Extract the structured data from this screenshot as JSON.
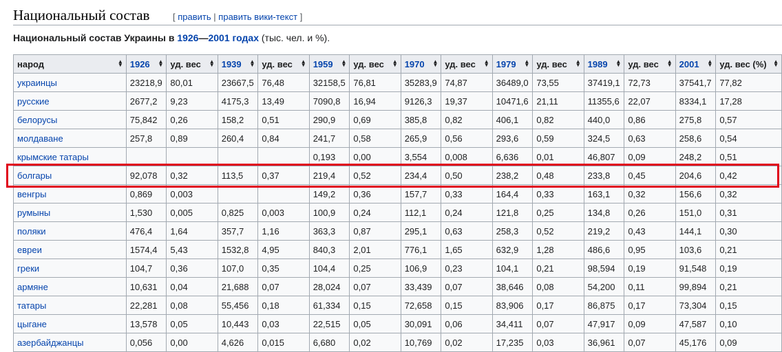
{
  "section": {
    "title": "Национальный состав",
    "edit_open": "[",
    "edit_link": "править",
    "edit_sep": "|",
    "edit_wiki_link": "править вики-текст",
    "edit_close": "]"
  },
  "caption": {
    "prefix": "Национальный состав Украины в ",
    "link1": "1926",
    "dash": "—",
    "link2": "2001 годах",
    "suffix": " (тыс. чел. и %)."
  },
  "table": {
    "headers": [
      "народ",
      "1926",
      "уд. вес",
      "1939",
      "уд. вес",
      "1959",
      "уд. вес",
      "1970",
      "уд. вес",
      "1979",
      "уд. вес",
      "1989",
      "уд. вес",
      "2001",
      "уд. вес (%)"
    ],
    "rows": [
      [
        "украинцы",
        "23218,9",
        "80,01",
        "23667,5",
        "76,48",
        "32158,5",
        "76,81",
        "35283,9",
        "74,87",
        "36489,0",
        "73,55",
        "37419,1",
        "72,73",
        "37541,7",
        "77,82"
      ],
      [
        "русские",
        "2677,2",
        "9,23",
        "4175,3",
        "13,49",
        "7090,8",
        "16,94",
        "9126,3",
        "19,37",
        "10471,6",
        "21,11",
        "11355,6",
        "22,07",
        "8334,1",
        "17,28"
      ],
      [
        "белорусы",
        "75,842",
        "0,26",
        "158,2",
        "0,51",
        "290,9",
        "0,69",
        "385,8",
        "0,82",
        "406,1",
        "0,82",
        "440,0",
        "0,86",
        "275,8",
        "0,57"
      ],
      [
        "молдаване",
        "257,8",
        "0,89",
        "260,4",
        "0,84",
        "241,7",
        "0,58",
        "265,9",
        "0,56",
        "293,6",
        "0,59",
        "324,5",
        "0,63",
        "258,6",
        "0,54"
      ],
      [
        "крымские татары",
        "",
        "",
        "",
        "",
        "0,193",
        "0,00",
        "3,554",
        "0,008",
        "6,636",
        "0,01",
        "46,807",
        "0,09",
        "248,2",
        "0,51"
      ],
      [
        "болгары",
        "92,078",
        "0,32",
        "113,5",
        "0,37",
        "219,4",
        "0,52",
        "234,4",
        "0,50",
        "238,2",
        "0,48",
        "233,8",
        "0,45",
        "204,6",
        "0,42"
      ],
      [
        "венгры",
        "0,869",
        "0,003",
        "",
        "",
        "149,2",
        "0,36",
        "157,7",
        "0,33",
        "164,4",
        "0,33",
        "163,1",
        "0,32",
        "156,6",
        "0,32"
      ],
      [
        "румыны",
        "1,530",
        "0,005",
        "0,825",
        "0,003",
        "100,9",
        "0,24",
        "112,1",
        "0,24",
        "121,8",
        "0,25",
        "134,8",
        "0,26",
        "151,0",
        "0,31"
      ],
      [
        "поляки",
        "476,4",
        "1,64",
        "357,7",
        "1,16",
        "363,3",
        "0,87",
        "295,1",
        "0,63",
        "258,3",
        "0,52",
        "219,2",
        "0,43",
        "144,1",
        "0,30"
      ],
      [
        "евреи",
        "1574,4",
        "5,43",
        "1532,8",
        "4,95",
        "840,3",
        "2,01",
        "776,1",
        "1,65",
        "632,9",
        "1,28",
        "486,6",
        "0,95",
        "103,6",
        "0,21"
      ],
      [
        "греки",
        "104,7",
        "0,36",
        "107,0",
        "0,35",
        "104,4",
        "0,25",
        "106,9",
        "0,23",
        "104,1",
        "0,21",
        "98,594",
        "0,19",
        "91,548",
        "0,19"
      ],
      [
        "армяне",
        "10,631",
        "0,04",
        "21,688",
        "0,07",
        "28,024",
        "0,07",
        "33,439",
        "0,07",
        "38,646",
        "0,08",
        "54,200",
        "0,11",
        "99,894",
        "0,21"
      ],
      [
        "татары",
        "22,281",
        "0,08",
        "55,456",
        "0,18",
        "61,334",
        "0,15",
        "72,658",
        "0,15",
        "83,906",
        "0,17",
        "86,875",
        "0,17",
        "73,304",
        "0,15"
      ],
      [
        "цыгане",
        "13,578",
        "0,05",
        "10,443",
        "0,03",
        "22,515",
        "0,05",
        "30,091",
        "0,06",
        "34,411",
        "0,07",
        "47,917",
        "0,09",
        "47,587",
        "0,10"
      ],
      [
        "азербайджанцы",
        "0,056",
        "0,00",
        "4,626",
        "0,015",
        "6,680",
        "0,02",
        "10,769",
        "0,02",
        "17,235",
        "0,03",
        "36,961",
        "0,07",
        "45,176",
        "0,09"
      ]
    ]
  },
  "colors": {
    "link": "#0645ad",
    "highlight": "#e0001b",
    "header_bg": "#eaecf0",
    "cell_bg": "#f8f9fa"
  },
  "icons": {
    "sort": "sort-arrows-icon"
  }
}
